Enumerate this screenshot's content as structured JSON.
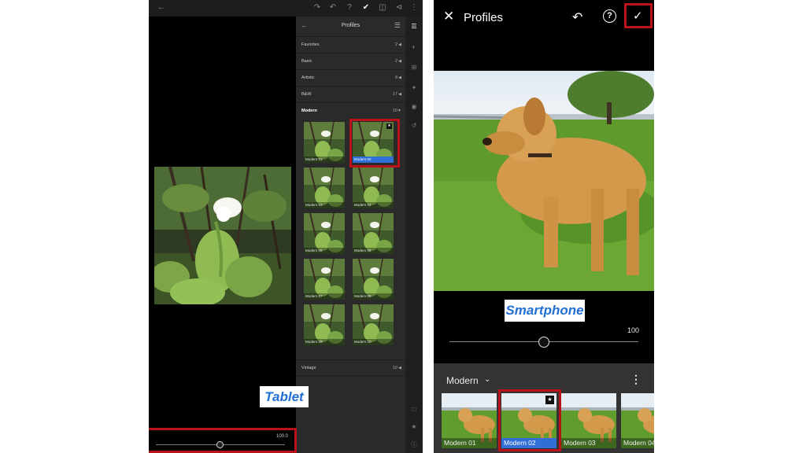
{
  "tablet": {
    "panel_title": "Profiles",
    "categories": [
      {
        "name": "Favorites",
        "count": "2"
      },
      {
        "name": "Basic",
        "count": "2"
      },
      {
        "name": "Artistic",
        "count": "8"
      },
      {
        "name": "B&W",
        "count": "17"
      },
      {
        "name": "Modern",
        "count": "10"
      }
    ],
    "thumbnails": [
      "Modern 01",
      "Modern 02",
      "Modern 03",
      "Modern 04",
      "Modern 05",
      "Modern 06",
      "Modern 07",
      "Modern 08",
      "Modern 09",
      "Modern 10"
    ],
    "selected_thumbnail": "Modern 02",
    "last_category": {
      "name": "Vintage",
      "count": "10"
    },
    "amount_value": "100.0",
    "amount_fraction": 0.5,
    "caption": "Tablet"
  },
  "phone": {
    "title": "Profiles",
    "caption": "Smartphone",
    "amount_value": "100",
    "amount_fraction": 0.5,
    "group": "Modern",
    "thumbnails": [
      "Modern 01",
      "Modern 02",
      "Modern 03",
      "Modern 04"
    ],
    "selected_thumbnail": "Modern 02"
  },
  "colors": {
    "highlight_red": "#b8121a",
    "selection_blue": "#2f6fd6",
    "caption_blue": "#2170d6"
  }
}
